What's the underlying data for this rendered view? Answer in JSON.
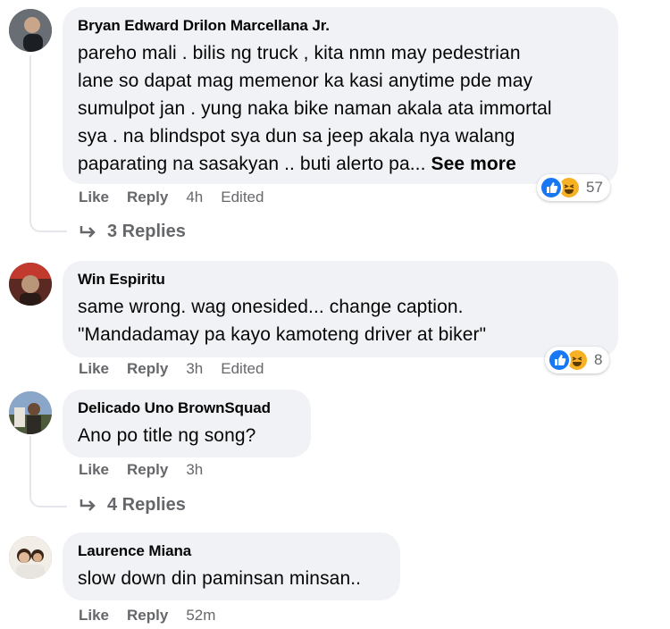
{
  "comments": [
    {
      "author": "Bryan Edward Drilon Marcellana Jr.",
      "lines": [
        "pareho mali . bilis ng truck , kita nmn may pedestrian",
        "lane so dapat mag memenor ka kasi anytime pde may",
        "sumulpot jan . yung naka bike naman akala ata immortal",
        "sya . na blindspot sya dun sa jeep akala nya walang",
        "paparating na sasakyan .. buti alerto pa..."
      ],
      "see_more": "See more",
      "like": "Like",
      "reply": "Reply",
      "time": "4h",
      "edited": "Edited",
      "reactions": "57",
      "replies": "3 Replies",
      "avatar_colors": [
        "#2d3a45",
        "#d8d2c8"
      ]
    },
    {
      "author": "Win Espiritu",
      "lines": [
        "same wrong. wag onesided... change caption.",
        "\"Mandadamay pa kayo kamoteng driver at biker\""
      ],
      "like": "Like",
      "reply": "Reply",
      "time": "3h",
      "edited": "Edited",
      "reactions": "8",
      "avatar_colors": [
        "#5a2a22",
        "#c23a2e"
      ]
    },
    {
      "author": "Delicado Uno BrownSquad",
      "lines": [
        "Ano po title ng song?"
      ],
      "like": "Like",
      "reply": "Reply",
      "time": "3h",
      "replies": "4 Replies",
      "avatar_colors": [
        "#8aa7c9",
        "#4d5a3a"
      ]
    },
    {
      "author": "Laurence Miana",
      "lines": [
        "slow down din paminsan minsan.."
      ],
      "like": "Like",
      "reply": "Reply",
      "time": "52m",
      "avatar_colors": [
        "#f2ede6",
        "#3a2418"
      ]
    }
  ],
  "colors": {
    "bubble": "#f0f2f5",
    "meta": "#65676b",
    "like_blue": "#1877f2",
    "haha_yellow": "#f7b125"
  },
  "icons": {
    "like_reaction": "thumbs-up-icon",
    "haha_reaction": "laughing-face-icon",
    "reply_arrow": "reply-arrow-icon"
  }
}
